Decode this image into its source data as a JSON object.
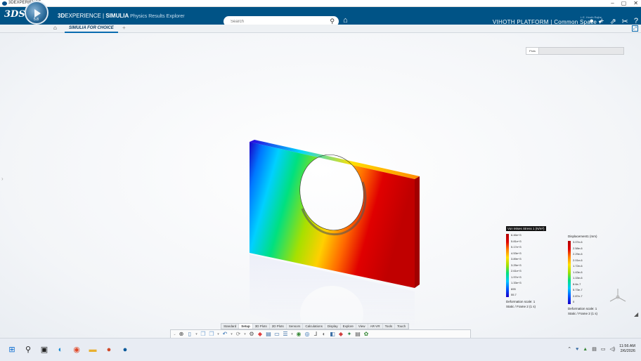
{
  "window": {
    "title": "3DEXPERIENCE",
    "controls": [
      "–",
      "▢",
      "✕"
    ]
  },
  "header": {
    "ds_logo": "3DS",
    "compass_version": "5.8",
    "brand_prefix": "3D",
    "brand_experience": "EXPERIENCE",
    "brand_sep": " | ",
    "brand_product": "SIMULIA",
    "brand_app": " Physics Results Explorer",
    "search_placeholder": "Search",
    "user_name": "L.E. Hvoth Rajhe",
    "platform": "VIHOTH PLATFORM",
    "space": "Common Space",
    "icons": [
      "avatar-icon",
      "plus-icon",
      "share-icon",
      "compass-tools-icon",
      "help-icon"
    ]
  },
  "tabs": {
    "active_tab": "SIMULIA FOR CHOICE",
    "add": "+"
  },
  "viewport": {
    "plots_label": "Plots",
    "stress_legend": {
      "title": "Von Mises Stress 1 (N/m²)",
      "values": [
        "6.46e+3",
        "5.81e+3",
        "5.17e+3",
        "4.53e+3",
        "3.89e+3",
        "3.25e+3",
        "2.61e+3",
        "1.97e+3",
        "1.33e+3",
        "695",
        "55.7"
      ],
      "deformation_scale": "Deformation scale: 1",
      "frame": "Static / Frame 2 (1 s)"
    },
    "disp_legend": {
      "title": "Displacement1 (mm)",
      "values": [
        "3.07e-6",
        "2.58e-6",
        "2.29e-6",
        "2.01e-6",
        "1.72e-6",
        "1.43e-6",
        "1.15e-6",
        "8.6e-7",
        "5.73e-7",
        "2.87e-7",
        "0"
      ],
      "deformation_scale": "Deformation scale: 1",
      "frame": "Static / Frame 2 (1 s)"
    },
    "colors": {
      "legend_gradient": [
        "#1a00c8",
        "#0055ff",
        "#00c8ff",
        "#00e080",
        "#a0e000",
        "#ffe000",
        "#ff8000",
        "#e00000",
        "#b00000"
      ]
    }
  },
  "action_bar": {
    "tabs": [
      "Standard",
      "Setup",
      "3D Plots",
      "2D Plots",
      "Sensors",
      "Calculations",
      "Display",
      "Explore",
      "View",
      "AR-VR",
      "Tools",
      "Touch"
    ],
    "active_tab": "Setup"
  },
  "taskbar": {
    "time": "11:56 AM",
    "date": "2/6/2026"
  }
}
